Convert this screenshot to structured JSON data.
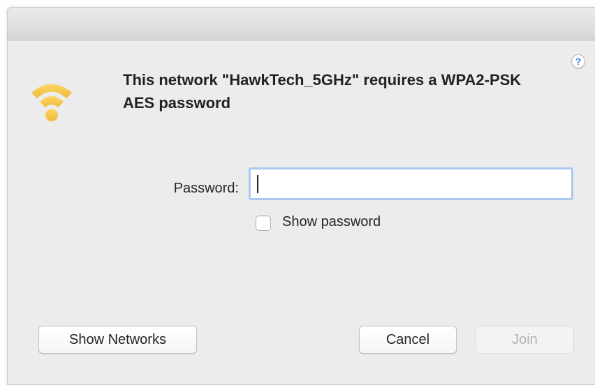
{
  "dialog": {
    "help_label": "?",
    "message": "This network \"HawkTech_5GHz\" requires a WPA2-PSK AES password",
    "password_label": "Password:",
    "password_value": "",
    "show_password_label": "Show password",
    "show_password_checked": false,
    "buttons": {
      "show_networks": "Show Networks",
      "cancel": "Cancel",
      "join": "Join"
    },
    "join_enabled": false,
    "icons": {
      "wifi": "wifi-icon",
      "help": "help-icon"
    },
    "colors": {
      "wifi_icon": "#f6c84c",
      "focus_ring": "#a9c8f0",
      "help_accent": "#3a7de8"
    }
  }
}
